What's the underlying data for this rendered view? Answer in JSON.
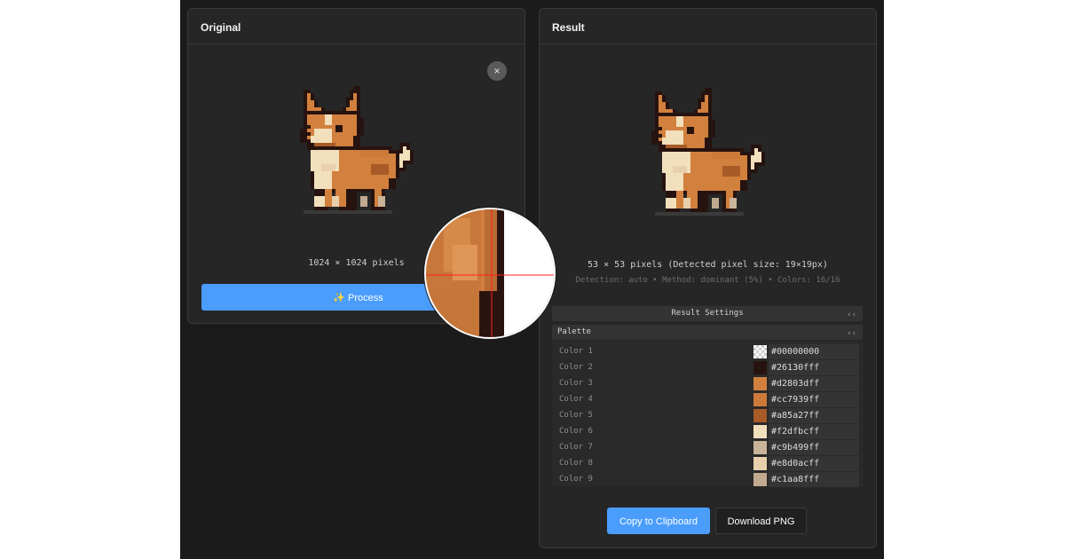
{
  "original_panel": {
    "title": "Original",
    "clear_icon": "×",
    "dimensions": "1024 × 1024 pixels",
    "process_label": "✨ Process"
  },
  "result_panel": {
    "title": "Result",
    "dimensions": "53 × 53 pixels (Detected pixel size: 19×19px)",
    "detection_info": "Detection: auto • Method: dominant (5%) • Colors: 16/16",
    "settings_label": "Result Settings",
    "settings_chevron": "‹‹",
    "palette_label": "Palette",
    "palette_chevron": "‹‹",
    "palette": [
      {
        "label": "Color 1",
        "hex": "#00000000",
        "swatch": "transparent"
      },
      {
        "label": "Color 2",
        "hex": "#26130fff",
        "swatch": "#26130f"
      },
      {
        "label": "Color 3",
        "hex": "#d2803dff",
        "swatch": "#d2803d"
      },
      {
        "label": "Color 4",
        "hex": "#cc7939ff",
        "swatch": "#cc7939"
      },
      {
        "label": "Color 5",
        "hex": "#a85a27ff",
        "swatch": "#a85a27"
      },
      {
        "label": "Color 6",
        "hex": "#f2dfbcff",
        "swatch": "#f2dfbc"
      },
      {
        "label": "Color 7",
        "hex": "#c9b499ff",
        "swatch": "#c9b499"
      },
      {
        "label": "Color 8",
        "hex": "#e8d0acff",
        "swatch": "#e8d0ac"
      },
      {
        "label": "Color 9",
        "hex": "#c1aa8fff",
        "swatch": "#c1aa8f"
      }
    ],
    "copy_label": "Copy to Clipboard",
    "download_label": "Download PNG"
  },
  "image_icon": "pixel-corgi-icon",
  "magnifier_icon": "magnifier-loupe-icon",
  "colors": {
    "accent": "#4a9dfb",
    "background": "#1b1b1b",
    "panel": "#262626"
  }
}
